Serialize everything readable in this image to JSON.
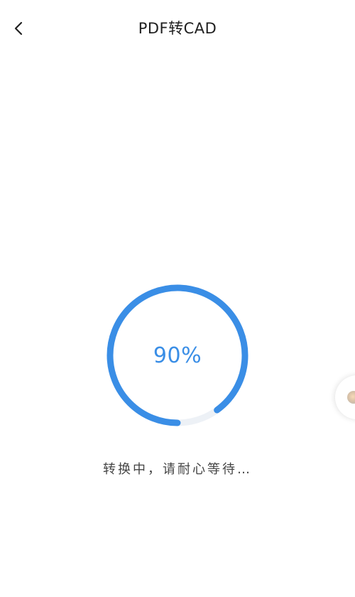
{
  "header": {
    "title": "PDF转CAD",
    "back_icon": "chevron-left-icon"
  },
  "progress": {
    "value": 0.9,
    "label": "90%",
    "color": "#3a8ee6",
    "track_color": "#edf1f6"
  },
  "status": {
    "message": "转换中，请耐心等待…"
  },
  "floating_widget": {
    "icon": "assistant-icon"
  }
}
